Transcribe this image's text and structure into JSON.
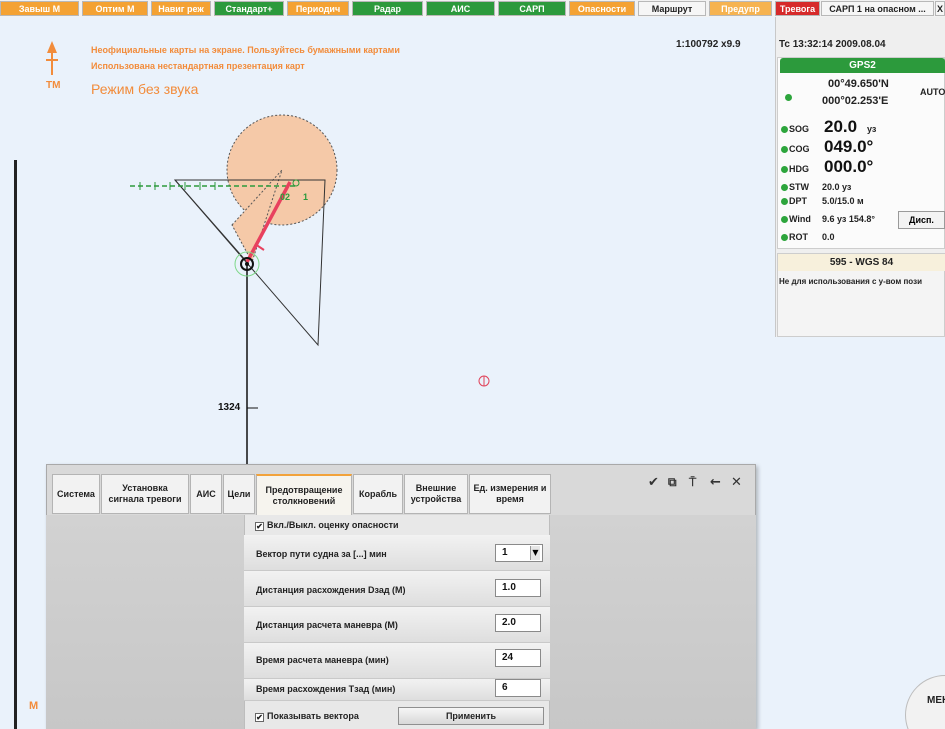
{
  "toolbar": {
    "buttons": [
      "Завыш М",
      "Оптим М",
      "Навиг реж",
      "Стандарт+",
      "Периодич",
      "Радар",
      "АИС",
      "САРП",
      "Опасности",
      "Маршрут",
      "Предупр"
    ],
    "alarm_label": "Тревога",
    "alarm_text": "САРП 1 на опасном ...",
    "close_label": "X"
  },
  "chart": {
    "notice_1": "Неофициальные карты на экране. Пользуйтесь бумажными картами",
    "notice_2": "Использована нестандартная презентация карт",
    "silent_mode": "Режим без звука",
    "mode_label": "TM",
    "scale": "1:100792 x9.9",
    "depth_label": "1324",
    "target_id": "02",
    "target_num": "1",
    "corner_label": "M"
  },
  "nav": {
    "time_label": "Tc 13:32:14  2009.08.04",
    "gps_title": "GPS2",
    "lat": "00°49.650'N",
    "lon": "000°02.253'E",
    "auto": "AUTO",
    "sog_label": "SOG",
    "sog_value": "20.0",
    "sog_unit": "уз",
    "cog_label": "COG",
    "cog_value": "049.0°",
    "hdg_label": "HDG",
    "hdg_value": "000.0°",
    "stw_label": "STW",
    "stw_value": "20.0 уз",
    "dpt_label": "DPT",
    "dpt_value": "5.0/15.0 м",
    "wind_label": "Wind",
    "wind_value": "9.6 уз  154.8°",
    "rot_label": "ROT",
    "rot_value": "0.0",
    "disp_button": "Дисп.",
    "datum_title": "595 - WGS 84",
    "datum_note": "Не для использования с у-вом пози"
  },
  "dialog": {
    "tabs": [
      "Система",
      "Установка сигнала тревоги",
      "АИС",
      "Цели",
      "Предотвращение столкновений",
      "Корабль",
      "Внешние устройства",
      "Ед. измерения и время"
    ],
    "active_tab": "Предотвращение столкновений",
    "toggle_assessment": "Вкл./Выкл. оценку опасности",
    "fields": [
      {
        "label": "Вектор пути судна за [...] мин",
        "value": "1"
      },
      {
        "label": "Дистанция расхождения Dзад (М)",
        "value": "1.0"
      },
      {
        "label": "Дистанция расчета маневра (М)",
        "value": "2.0"
      },
      {
        "label": "Время расчета маневра (мин)",
        "value": "24"
      },
      {
        "label": "Время расхождения Тзад (мин)",
        "value": "6"
      }
    ],
    "show_vectors": "Показывать вектора",
    "apply_button": "Применить"
  },
  "menu_button": "МЕН",
  "colors": {
    "orange": "#f4a233",
    "green": "#2c9a3c",
    "alarm_red": "#d62a2a",
    "warning_text": "#f28c3b",
    "danger_zone": "#f5c9a8",
    "vector_red": "#e8415e"
  }
}
